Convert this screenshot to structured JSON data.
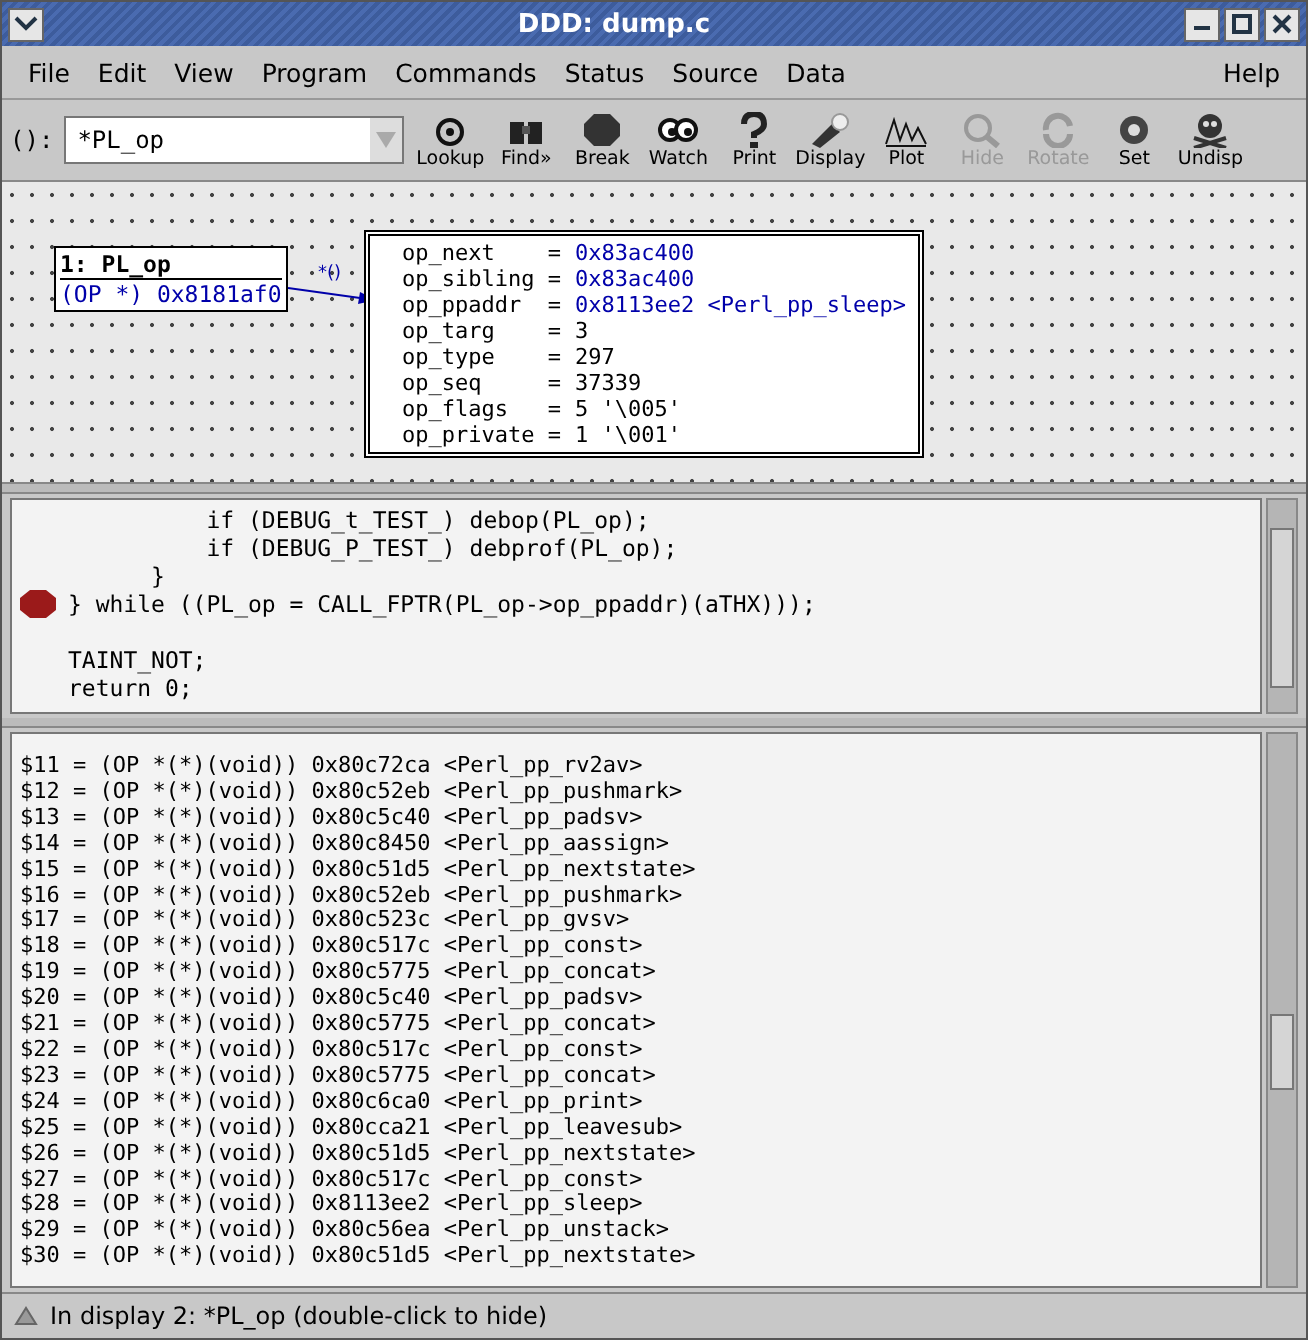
{
  "window": {
    "title": "DDD: dump.c"
  },
  "menu": [
    {
      "label": "File"
    },
    {
      "label": "Edit"
    },
    {
      "label": "View"
    },
    {
      "label": "Program"
    },
    {
      "label": "Commands"
    },
    {
      "label": "Status"
    },
    {
      "label": "Source"
    },
    {
      "label": "Data"
    },
    {
      "label": "Help"
    }
  ],
  "argument": {
    "label": "():",
    "value": "*PL_op"
  },
  "toolbar": [
    {
      "label": "Lookup",
      "disabled": false
    },
    {
      "label": "Find»",
      "disabled": false
    },
    {
      "label": "Break",
      "disabled": false
    },
    {
      "label": "Watch",
      "disabled": false
    },
    {
      "label": "Print",
      "disabled": false
    },
    {
      "label": "Display",
      "disabled": false
    },
    {
      "label": "Plot",
      "disabled": false
    },
    {
      "label": "Hide",
      "disabled": true
    },
    {
      "label": "Rotate",
      "disabled": true
    },
    {
      "label": "Set",
      "disabled": false
    },
    {
      "label": "Undisp",
      "disabled": false
    }
  ],
  "displays": {
    "node": {
      "title": "1: PL_op",
      "value": "(OP *) 0x8181af0"
    },
    "edge_label": "*()",
    "fields": [
      {
        "label": "op_next    =",
        "value": "0x83ac400",
        "pointer": true
      },
      {
        "label": "op_sibling =",
        "value": "0x83ac400",
        "pointer": true
      },
      {
        "label": "op_ppaddr  =",
        "value": "0x8113ee2 <Perl_pp_sleep>",
        "pointer": true
      },
      {
        "label": "op_targ    =",
        "value": "3",
        "pointer": false
      },
      {
        "label": "op_type    =",
        "value": "297",
        "pointer": false
      },
      {
        "label": "op_seq     =",
        "value": "37339",
        "pointer": false
      },
      {
        "label": "op_flags   =",
        "value": "5 '\\005'",
        "pointer": false
      },
      {
        "label": "op_private =",
        "value": "1 '\\001'",
        "pointer": false
      }
    ]
  },
  "source": [
    {
      "text": "          if (DEBUG_t_TEST_) debop(PL_op);",
      "breakpoint": false
    },
    {
      "text": "          if (DEBUG_P_TEST_) debprof(PL_op);",
      "breakpoint": false
    },
    {
      "text": "      }",
      "breakpoint": false
    },
    {
      "text": "} while ((PL_op = CALL_FPTR(PL_op->op_ppaddr)(aTHX)));",
      "breakpoint": true
    },
    {
      "breakpoint": false
    },
    {
      "text": "TAINT_NOT;",
      "breakpoint": false
    },
    {
      "text": "return 0;",
      "breakpoint": false
    }
  ],
  "console": [
    "$11 = (OP *(*)(void)) 0x80c72ca <Perl_pp_rv2av>",
    "$12 = (OP *(*)(void)) 0x80c52eb <Perl_pp_pushmark>",
    "$13 = (OP *(*)(void)) 0x80c5c40 <Perl_pp_padsv>",
    "$14 = (OP *(*)(void)) 0x80c8450 <Perl_pp_aassign>",
    "$15 = (OP *(*)(void)) 0x80c51d5 <Perl_pp_nextstate>",
    "$16 = (OP *(*)(void)) 0x80c52eb <Perl_pp_pushmark>",
    "$17 = (OP *(*)(void)) 0x80c523c <Perl_pp_gvsv>",
    "$18 = (OP *(*)(void)) 0x80c517c <Perl_pp_const>",
    "$19 = (OP *(*)(void)) 0x80c5775 <Perl_pp_concat>",
    "$20 = (OP *(*)(void)) 0x80c5c40 <Perl_pp_padsv>",
    "$21 = (OP *(*)(void)) 0x80c5775 <Perl_pp_concat>",
    "$22 = (OP *(*)(void)) 0x80c517c <Perl_pp_const>",
    "$23 = (OP *(*)(void)) 0x80c5775 <Perl_pp_concat>",
    "$24 = (OP *(*)(void)) 0x80c6ca0 <Perl_pp_print>",
    "$25 = (OP *(*)(void)) 0x80cca21 <Perl_pp_leavesub>",
    "$26 = (OP *(*)(void)) 0x80c51d5 <Perl_pp_nextstate>",
    "$27 = (OP *(*)(void)) 0x80c517c <Perl_pp_const>",
    "$28 = (OP *(*)(void)) 0x8113ee2 <Perl_pp_sleep>",
    "$29 = (OP *(*)(void)) 0x80c56ea <Perl_pp_unstack>",
    "$30 = (OP *(*)(void)) 0x80c51d5 <Perl_pp_nextstate>"
  ],
  "status_bar": "In display 2: *PL_op (double-click to hide)"
}
